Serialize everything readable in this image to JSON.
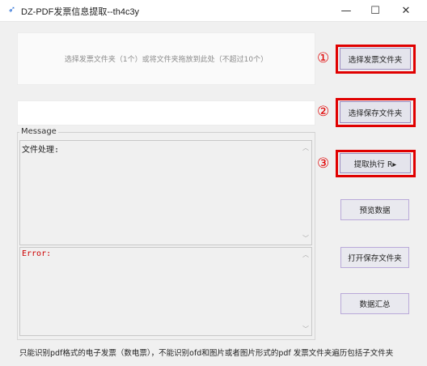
{
  "window": {
    "title": "DZ-PDF发票信息提取--th4c3y",
    "icon": "feather-icon",
    "minimize": "—",
    "maximize": "☐",
    "close": "✕"
  },
  "drop_zone": {
    "text": "选择发票文件夹（1个）或将文件夹拖放到此处（不超过10个）"
  },
  "save_path": {
    "value": ""
  },
  "steps": [
    "①",
    "②",
    "③"
  ],
  "buttons": {
    "select_invoice_folder": "选择发票文件夹",
    "select_save_folder": "选择保存文件夹",
    "extract_run": "提取执行 R▸",
    "preview_data": "预览数据",
    "open_save_folder": "打开保存文件夹",
    "data_summary": "数据汇总"
  },
  "message": {
    "legend": "Message",
    "file_processing": "文件处理:",
    "error": "Error:"
  },
  "footer": {
    "note": "只能识别pdf格式的电子发票（数电票），不能识别ofd和图片或者图片形式的pdf  发票文件夹遍历包括子文件夹"
  },
  "colors": {
    "highlight": "#e00000",
    "error_text": "#cc0000",
    "button_border": "#b9a9d9"
  }
}
